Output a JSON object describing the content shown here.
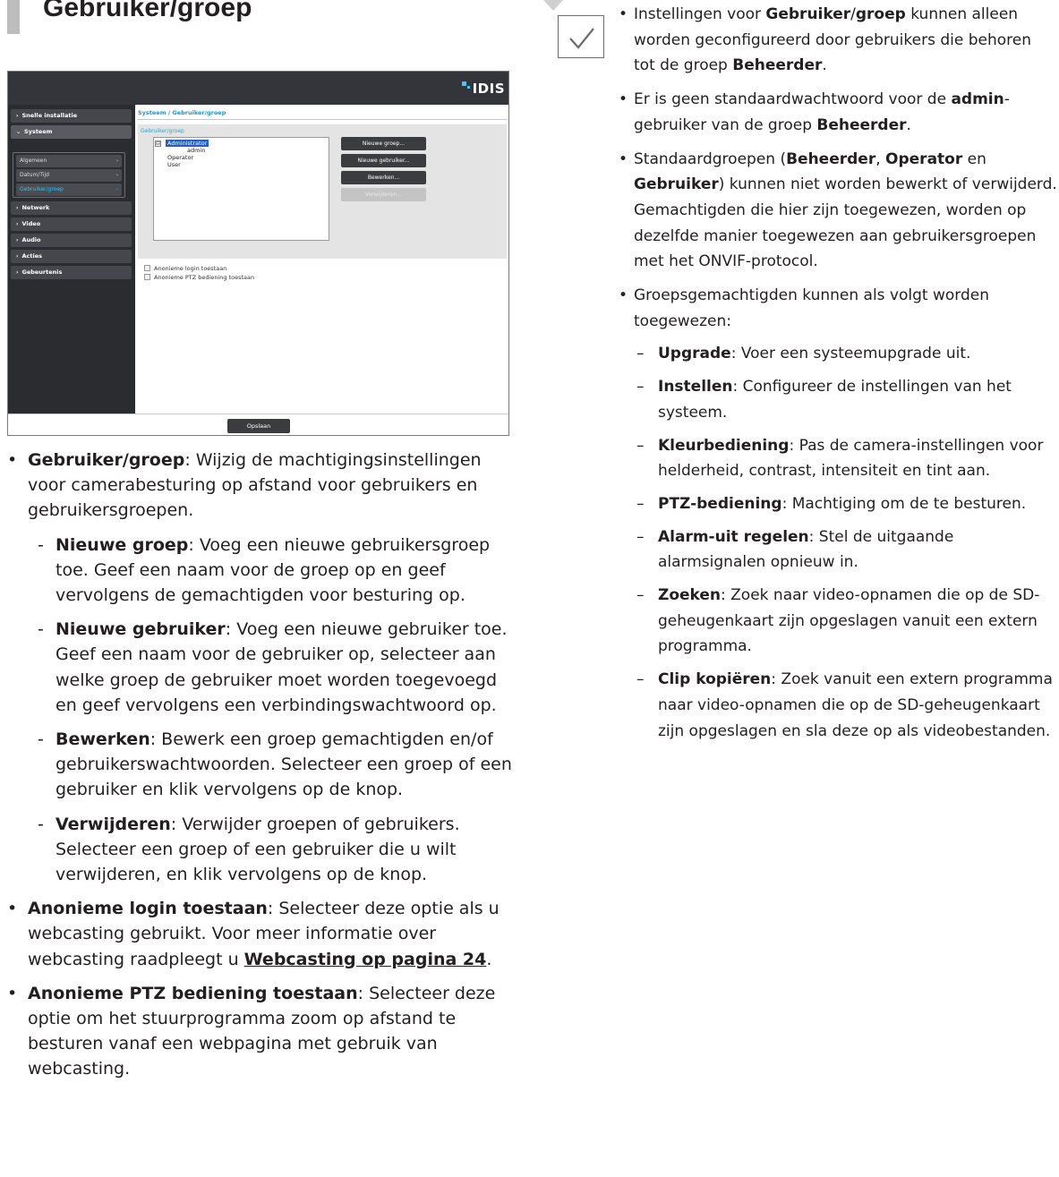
{
  "heading": "Gebruiker/groep",
  "screenshot": {
    "logo": "IDIS",
    "sidebar": {
      "items": [
        {
          "label": "Snelle installatie"
        },
        {
          "label": "Systeem"
        },
        {
          "label": "Netwerk"
        },
        {
          "label": "Video"
        },
        {
          "label": "Audio"
        },
        {
          "label": "Acties"
        },
        {
          "label": "Gebeurtenis"
        }
      ],
      "sub_items": [
        {
          "label": "Algemeen"
        },
        {
          "label": "Datum/Tijd"
        },
        {
          "label": "Gebruiker/groep"
        }
      ]
    },
    "breadcrumb": "Systeem / Gebruiker/groep",
    "panel_label": "Gebruiker/groep",
    "tree": {
      "administrator": "Administrator",
      "admin": "admin",
      "operator": "Operator",
      "user": "User",
      "toggle": "⊟"
    },
    "buttons": {
      "new_group": "Nieuwe groep...",
      "new_user": "Nieuwe gebruiker...",
      "edit": "Bewerken...",
      "delete": "Verwijderen..."
    },
    "checkboxes": {
      "anon_login": "Anonieme login toestaan",
      "anon_ptz": "Anonieme PTZ bediening toestaan"
    },
    "save": "Opslaan"
  },
  "left": {
    "bullet1": {
      "term": "Gebruiker/groep",
      "text": ": Wijzig de machtigingsinstellingen voor camerabesturing op afstand voor gebruikers en gebruikersgroepen."
    },
    "subs": [
      {
        "term": "Nieuwe groep",
        "text": ": Voeg een nieuwe gebruikersgroep toe. Geef een naam voor de groep op en geef vervolgens de gemachtigden voor besturing op."
      },
      {
        "term": "Nieuwe gebruiker",
        "text": ": Voeg een nieuwe gebruiker toe. Geef een naam voor de gebruiker op, selecteer aan welke groep de gebruiker moet worden toegevoegd en geef vervolgens een verbindingswachtwoord op."
      },
      {
        "term": "Bewerken",
        "text": ": Bewerk een groep gemachtigden en/of gebruikerswachtwoorden. Selecteer een groep of een gebruiker en klik vervolgens op de knop."
      },
      {
        "term": "Verwijderen",
        "text": ": Verwijder groepen of gebruikers. Selecteer een groep of een gebruiker die u wilt verwijderen, en klik vervolgens op de knop."
      }
    ],
    "bullet2": {
      "term": "Anonieme login toestaan",
      "text": ": Selecteer deze optie als u webcasting gebruikt. Voor meer informatie over webcasting raadpleegt u ",
      "link": "Webcasting op pagina 24",
      "end": "."
    },
    "bullet3": {
      "term": "Anonieme PTZ bediening toestaan",
      "text": ": Selecteer deze optie om het stuurprogramma zoom op afstand te besturen vanaf een webpagina met gebruik van webcasting."
    }
  },
  "note": {
    "icon": "checkmark-icon",
    "b1": {
      "a": "Instellingen voor ",
      "t1": "Gebruiker",
      "s": "/",
      "t2": "groep",
      "b": " kunnen alleen worden geconfigureerd door gebruikers die behoren tot de groep ",
      "t3": "Beheerder",
      "c": "."
    },
    "b2": {
      "a": "Er is geen standaardwachtwoord voor de ",
      "t1": "admin",
      "b": "-gebruiker van de groep ",
      "t2": "Beheerder",
      "c": "."
    },
    "b3": {
      "a": "Standaardgroepen (",
      "t1": "Beheerder",
      "s1": ", ",
      "t2": "Operator",
      "s2": " en ",
      "t3": "Gebruiker",
      "b": ") kunnen niet worden bewerkt of verwijderd. Gemachtigden die hier zijn toegewezen, worden op dezelfde manier toegewezen aan gebruikersgroepen met het ONVIF-protocol."
    },
    "b4": "Groepsgemachtigden kunnen als volgt worden toegewezen:",
    "perms": [
      {
        "term": "Upgrade",
        "text": ": Voer een systeemupgrade uit."
      },
      {
        "term": "Instellen",
        "text": ": Configureer de instellingen van het systeem."
      },
      {
        "term": "Kleurbediening",
        "text": ": Pas de camera-instellingen voor helderheid, contrast, intensiteit en tint aan."
      },
      {
        "term": "PTZ-bediening",
        "text": ": Machtiging om de  te besturen."
      },
      {
        "term": "Alarm-uit regelen",
        "text": ": Stel de uitgaande alarmsignalen opnieuw in."
      },
      {
        "term": "Zoeken",
        "text": ": Zoek naar video-opnamen die op de SD-geheugenkaart zijn opgeslagen vanuit een extern programma."
      },
      {
        "term": "Clip kopiëren",
        "text": ": Zoek vanuit een extern programma naar video-opnamen die op de SD-geheugenkaart zijn opgeslagen en sla deze op als videobestanden."
      }
    ]
  }
}
